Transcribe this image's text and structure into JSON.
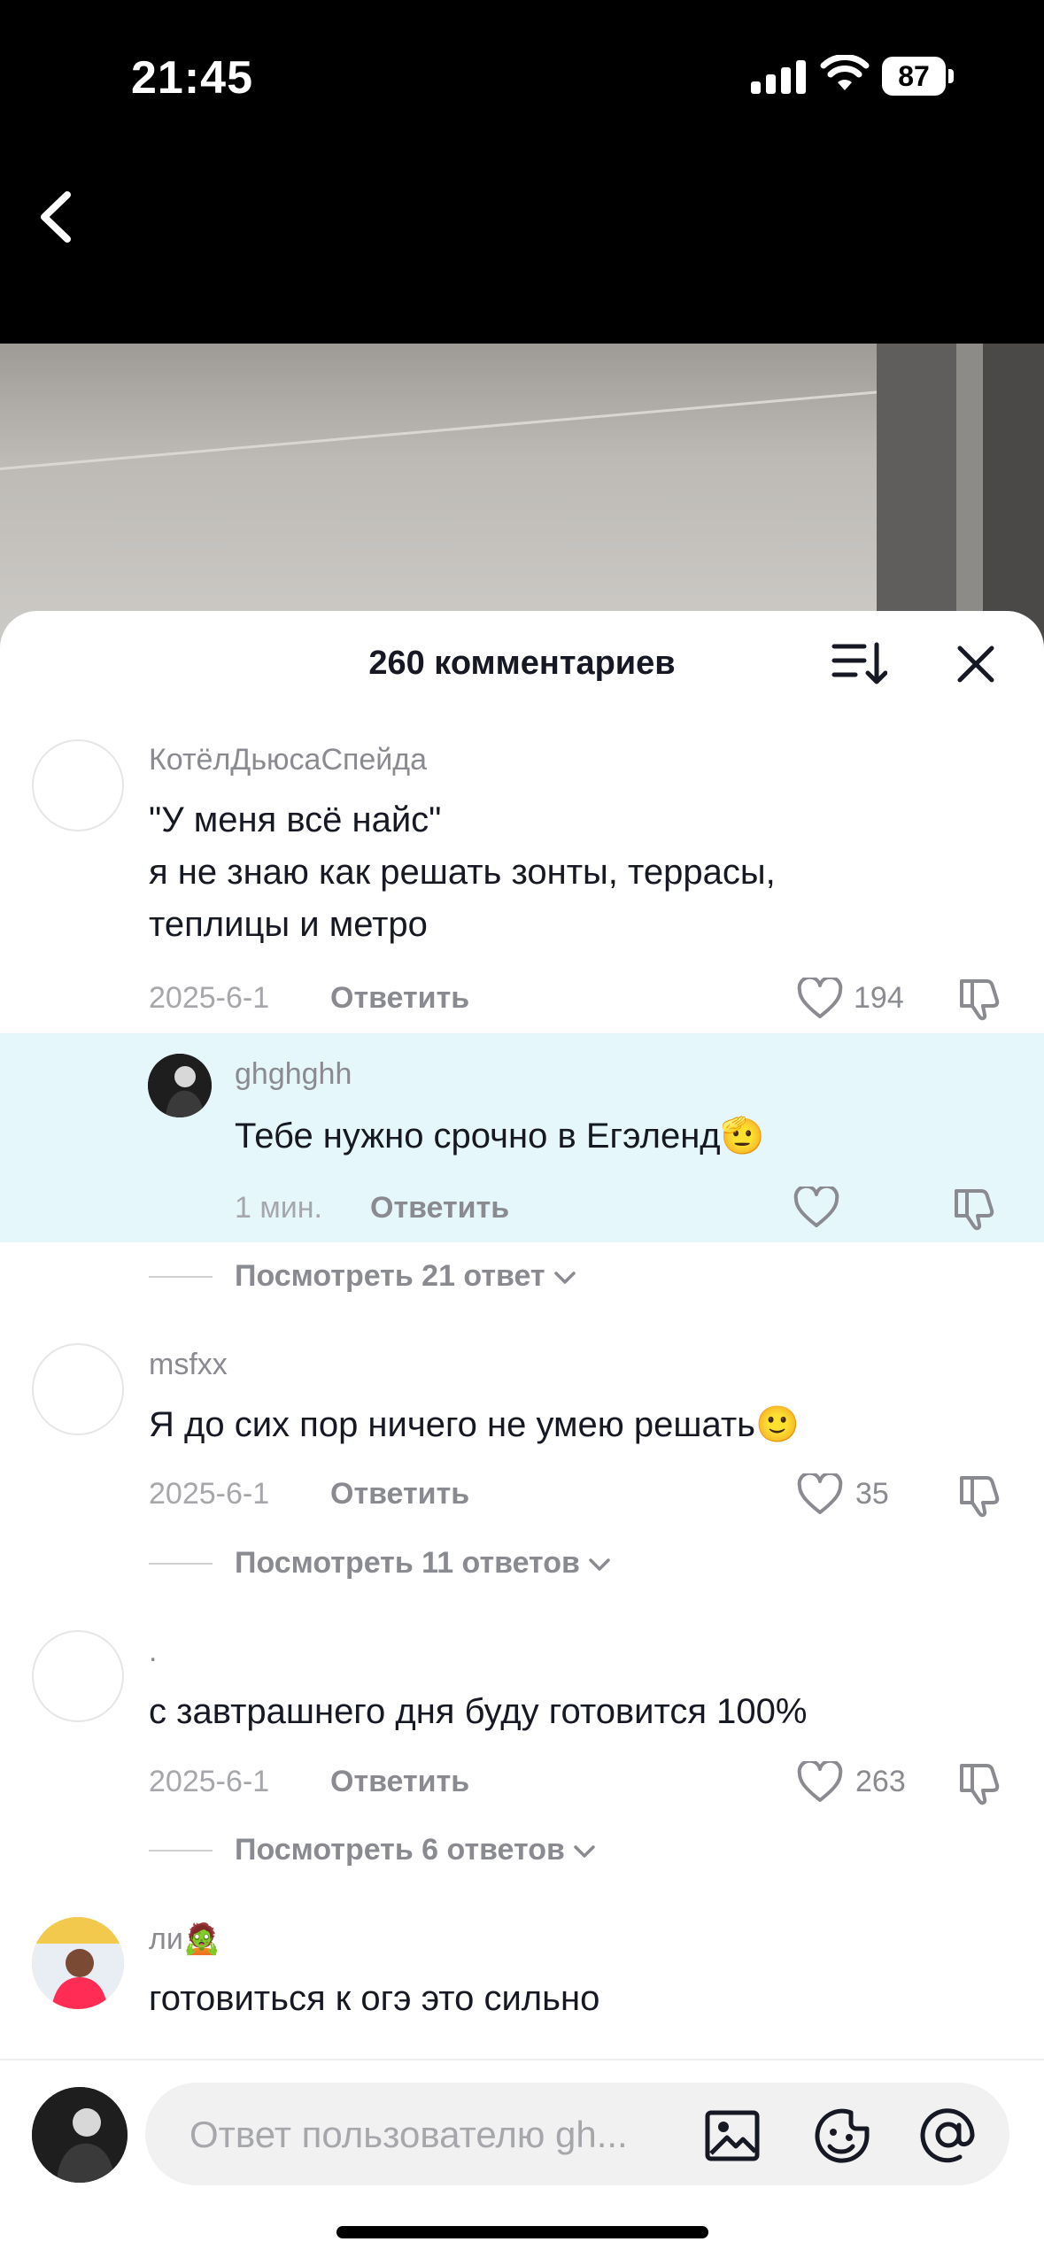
{
  "status_bar": {
    "time": "21:45",
    "battery": "87"
  },
  "sheet": {
    "title": "260 комментариев"
  },
  "comments": [
    {
      "username": "КотёлДьюсаСпейда",
      "text": "\"У меня всё найс\"\nя не знаю как решать зонты, террасы,\nтеплицы и метро",
      "date": "2025-6-1",
      "reply_label": "Ответить",
      "likes": "194",
      "replies": [
        {
          "username": "ghghghh",
          "text": "Тебе нужно срочно в Егэленд🫡",
          "date": "1 мин.",
          "reply_label": "Ответить"
        }
      ],
      "view_replies": "Посмотреть 21 ответ"
    },
    {
      "username": "msfxx",
      "text": "Я до сих пор ничего не умею решать🙂",
      "date": "2025-6-1",
      "reply_label": "Ответить",
      "likes": "35",
      "view_replies": "Посмотреть 11 ответов"
    },
    {
      "username": ".",
      "text": "с завтрашнего дня буду готовится 100%",
      "date": "2025-6-1",
      "reply_label": "Ответить",
      "likes": "263",
      "view_replies": "Посмотреть 6 ответов"
    },
    {
      "username": "ли🧟",
      "text": "готовиться к огэ это сильно"
    }
  ],
  "input": {
    "placeholder": "Ответ пользователю gh..."
  },
  "icons": [
    "back-icon",
    "sort-icon",
    "close-icon",
    "heart-icon",
    "dislike-icon",
    "image-icon",
    "emoji-icon",
    "mention-icon"
  ],
  "colors": {
    "highlight": "#e6f7fb",
    "text": "#161823",
    "muted": "#8a8b91"
  }
}
